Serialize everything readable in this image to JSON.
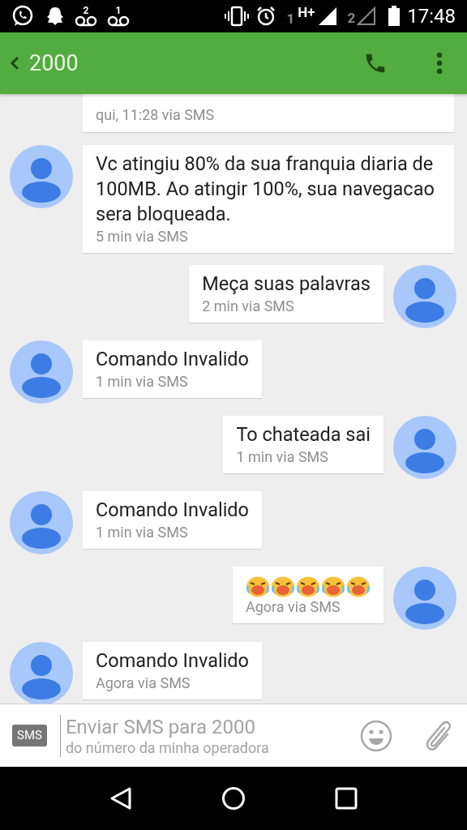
{
  "status_bar": {
    "voicemail_counts": [
      "2",
      "1"
    ],
    "sim1_label": "1",
    "network": "H+",
    "sim2_label": "2",
    "time": "17:48"
  },
  "header": {
    "title": "2000"
  },
  "messages": [
    {
      "kind": "continuation",
      "meta": "qui, 11:28 via SMS"
    },
    {
      "kind": "incoming",
      "text": "Vc atingiu 80% da sua franquia diaria de 100MB. Ao atingir 100%, sua navegacao sera bloqueada.",
      "meta": "5 min via SMS"
    },
    {
      "kind": "outgoing",
      "text": "Meça suas palavras",
      "meta": "2 min via SMS"
    },
    {
      "kind": "incoming",
      "text": "Comando Invalido",
      "meta": "1 min via SMS"
    },
    {
      "kind": "outgoing",
      "text": "To chateada sai",
      "meta": "1 min via SMS"
    },
    {
      "kind": "incoming",
      "text": "Comando Invalido",
      "meta": "1 min via SMS"
    },
    {
      "kind": "outgoing",
      "emojis": [
        {
          "kind": "crying-face"
        },
        {
          "kind": "crying-face"
        },
        {
          "kind": "crying-face"
        },
        {
          "kind": "crying-face"
        },
        {
          "kind": "crying-face"
        }
      ],
      "meta": "Agora via SMS"
    },
    {
      "kind": "incoming",
      "text": "Comando Invalido",
      "meta": "Agora via SMS"
    }
  ],
  "composer": {
    "badge": "SMS",
    "placeholder": "Enviar SMS para 2000",
    "subtitle": "do número da minha operadora"
  }
}
